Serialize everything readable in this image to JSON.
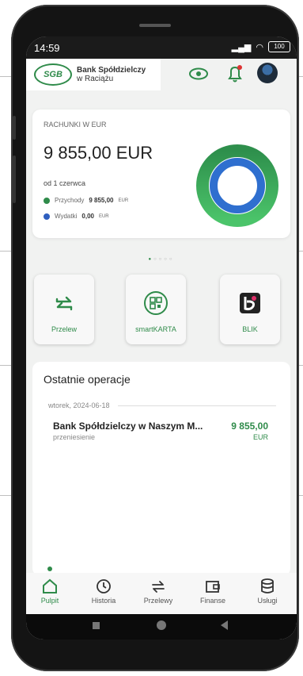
{
  "status": {
    "time": "14:59",
    "battery": "100"
  },
  "bank": {
    "logo_text": "SGB",
    "name_line1": "Bank Spółdzielczy",
    "name_line2": "w Raciążu"
  },
  "account": {
    "label": "RACHUNKI W EUR",
    "balance": "9 855,00 EUR",
    "since": "od 1 czerwca",
    "income_label": "Przychody",
    "income_value": "9 855,00",
    "income_currency": "EUR",
    "expense_label": "Wydatki",
    "expense_value": "0,00",
    "expense_currency": "EUR"
  },
  "tiles": [
    {
      "label": "Przelew",
      "icon": "transfer-icon"
    },
    {
      "label": "smartKARTA",
      "icon": "qr-card-icon"
    },
    {
      "label": "BLIK",
      "icon": "blik-icon"
    }
  ],
  "operations": {
    "title": "Ostatnie operacje",
    "date": "wtorek, 2024-06-18",
    "items": [
      {
        "name": "Bank Spółdzielczy w Naszym M...",
        "type": "przeniesienie",
        "amount": "9 855,00",
        "currency": "EUR"
      }
    ]
  },
  "nav": [
    {
      "label": "Pulpit",
      "icon": "home-icon",
      "active": true
    },
    {
      "label": "Historia",
      "icon": "history-icon",
      "active": false
    },
    {
      "label": "Przelewy",
      "icon": "transfers-icon",
      "active": false
    },
    {
      "label": "Finanse",
      "icon": "wallet-icon",
      "active": false
    },
    {
      "label": "Usługi",
      "icon": "database-icon",
      "active": false
    }
  ],
  "colors": {
    "brand_green": "#2f8b4a",
    "income_green": "#3aa65c",
    "expense_blue": "#2f6fcf"
  }
}
